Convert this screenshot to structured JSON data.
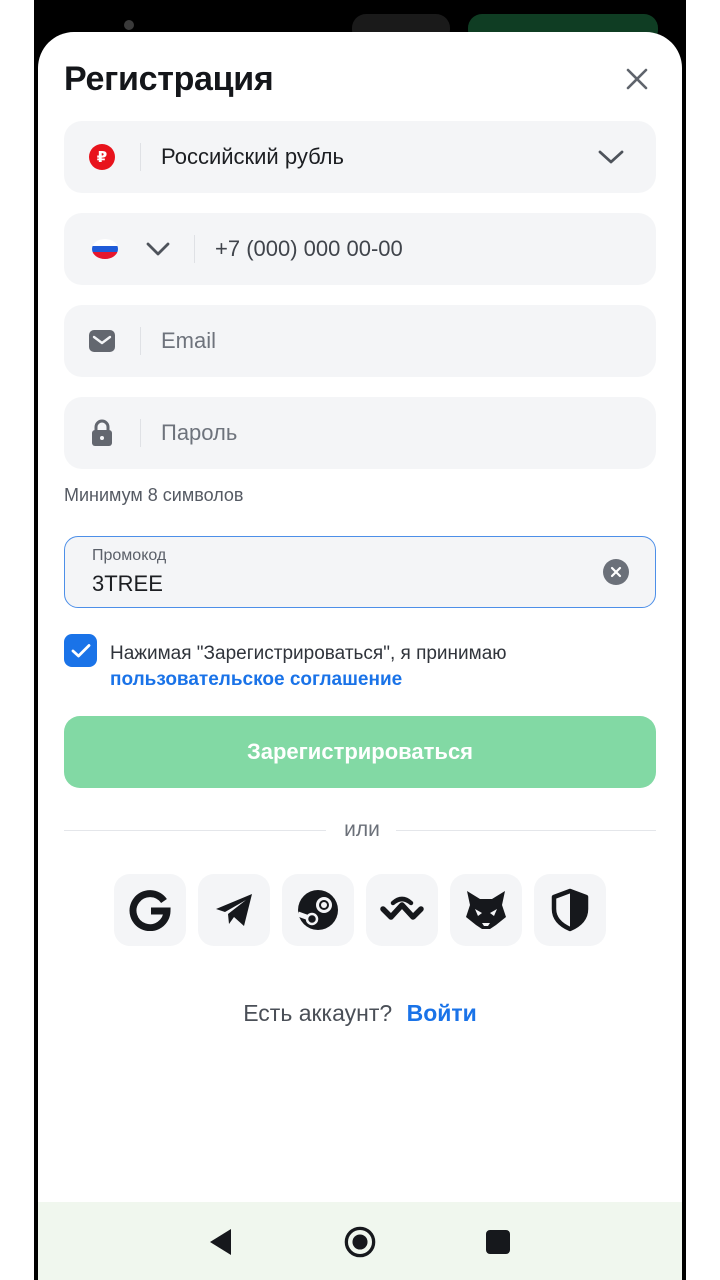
{
  "sheet": {
    "title": "Регистрация"
  },
  "currency": {
    "icon": "ruble-icon",
    "symbol": "₽",
    "value": "Российский рубль"
  },
  "phone": {
    "flag": "russia-flag-icon",
    "value": "+7 (000) 000 00-00"
  },
  "email": {
    "icon": "envelope-icon",
    "placeholder": "Email"
  },
  "password": {
    "icon": "lock-icon",
    "placeholder": "Пароль",
    "hint": "Минимум 8 символов"
  },
  "promo": {
    "label": "Промокод",
    "value": "3TREE"
  },
  "agreement": {
    "checked": true,
    "text": "Нажимая \"Зарегистрироваться\", я принимаю",
    "link": "пользовательское соглашение"
  },
  "submit": {
    "label": "Зарегистрироваться"
  },
  "divider": {
    "text": "или"
  },
  "social": [
    "google-icon",
    "telegram-icon",
    "steam-icon",
    "walletconnect-icon",
    "metamask-icon",
    "shield-icon"
  ],
  "footer": {
    "question": "Есть аккаунт?",
    "login": "Войти"
  },
  "colors": {
    "accent": "#1a73e8",
    "submit_disabled": "#82d9a4",
    "field_bg": "#f4f5f7"
  }
}
